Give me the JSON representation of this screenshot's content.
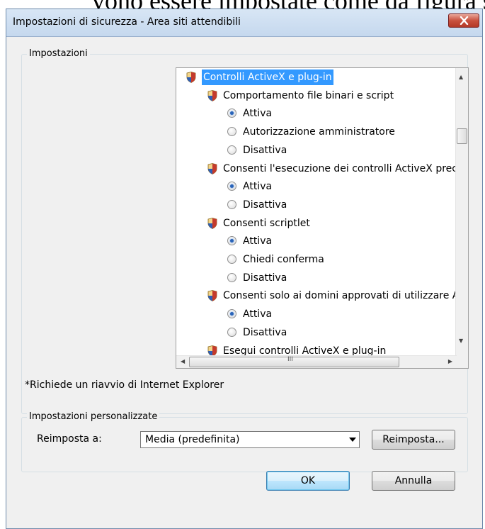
{
  "background_text": "vono essere impostate come da figura se",
  "window": {
    "title": "Impostazioni di sicurezza - Area siti attendibili",
    "close_icon": "close-x-icon"
  },
  "settings_group": {
    "label": "Impostazioni",
    "note": "*Richiede un riavvio di Internet Explorer"
  },
  "tree": {
    "category": "Controlli ActiveX e plug-in",
    "items": [
      {
        "title": "Comportamento file binari e script",
        "options": [
          "Attiva",
          "Autorizzazione amministratore",
          "Disattiva"
        ],
        "selected": 0
      },
      {
        "title": "Consenti l'esecuzione dei controlli ActiveX precedentemente inutil",
        "options": [
          "Attiva",
          "Disattiva"
        ],
        "selected": 0
      },
      {
        "title": "Consenti scriptlet",
        "options": [
          "Attiva",
          "Chiedi conferma",
          "Disattiva"
        ],
        "selected": 0
      },
      {
        "title": "Consenti solo ai domini approvati di utilizzare ActiveX senza chied",
        "options": [
          "Attiva",
          "Disattiva"
        ],
        "selected": 0
      },
      {
        "title": "Esegui controlli ActiveX e plug-in",
        "options": [],
        "selected": -1
      }
    ],
    "hscroll_grip": "III"
  },
  "custom_group": {
    "label": "Impostazioni personalizzate",
    "reset_label": "Reimposta a:",
    "reset_value": "Media (predefinita)",
    "reset_button": "Reimposta..."
  },
  "buttons": {
    "ok": "OK",
    "cancel": "Annulla"
  },
  "colors": {
    "selection": "#3399ff",
    "radio_dot": "#2a64b8",
    "close_button": "#c9513e"
  }
}
